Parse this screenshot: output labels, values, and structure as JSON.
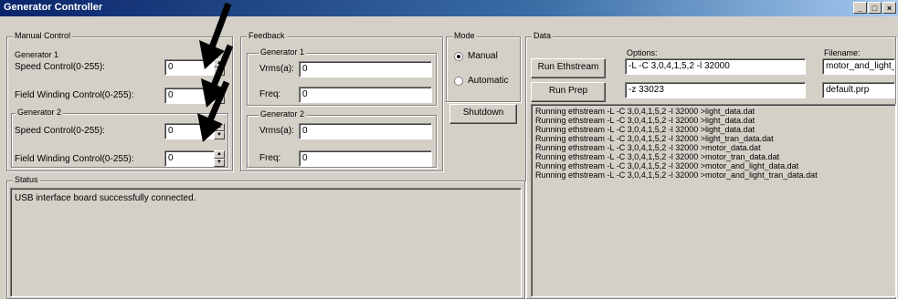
{
  "window": {
    "title": "Generator Controller",
    "buttons": [
      "_",
      "□",
      "×"
    ]
  },
  "manual": {
    "label": "Manual Control",
    "gen1": {
      "label": "Generator 1",
      "speed_label": "Speed Control(0-255):",
      "speed_value": "0",
      "field_label": "Field Winding Control(0-255):",
      "field_value": "0"
    },
    "gen2": {
      "label": "Generator 2",
      "speed_label": "Speed Control(0-255):",
      "speed_value": "0",
      "field_label": "Field Winding Control(0-255):",
      "field_value": "0"
    }
  },
  "feedback": {
    "label": "Feedback",
    "gen1": {
      "label": "Generator 1",
      "vrms_label": "Vrms(a):",
      "vrms_value": "0",
      "freq_label": "Freq:",
      "freq_value": "0"
    },
    "gen2": {
      "label": "Generator 2",
      "vrms_label": "Vrms(a):",
      "vrms_value": "0",
      "freq_label": "Freq:",
      "freq_value": "0"
    }
  },
  "mode": {
    "label": "Mode",
    "manual": "Manual",
    "automatic": "Automatic",
    "selected": "Manual",
    "shutdown": "Shutdown"
  },
  "data": {
    "label": "Data",
    "options_label": "Options:",
    "filename_label": "Filename:",
    "run_ethstream": "Run Ethstream",
    "run_prep": "Run Prep",
    "ethstream_options": "-L -C 3,0,4,1,5,2 -l 32000",
    "prep_options": "-z 33023",
    "ethstream_filename": "motor_and_light_",
    "prep_filename": "default.prp",
    "log": [
      "Running ethstream -L -C 3,0,4,1,5,2 -l 32000 >light_data.dat",
      "Running ethstream -L -C 3,0,4,1,5,2 -l 32000 >light_data.dat",
      "Running ethstream -L -C 3,0,4,1,5,2 -l 32000 >light_data.dat",
      "Running ethstream -L -C 3,0,4,1,5,2 -l 32000 >light_tran_data.dat",
      "Running ethstream -L -C 3,0,4,1,5,2 -l 32000 >motor_data.dat",
      "Running ethstream -L -C 3,0,4,1,5,2 -l 32000 >motor_tran_data.dat",
      "Running ethstream -L -C 3,0,4,1,5,2 -l 32000 >motor_and_light_data.dat",
      "Running ethstream -L -C 3,0,4,1,5,2 -l 32000 >motor_and_light_tran_data.dat"
    ]
  },
  "status": {
    "label": "Status",
    "message": "USB interface board successfully connected."
  }
}
